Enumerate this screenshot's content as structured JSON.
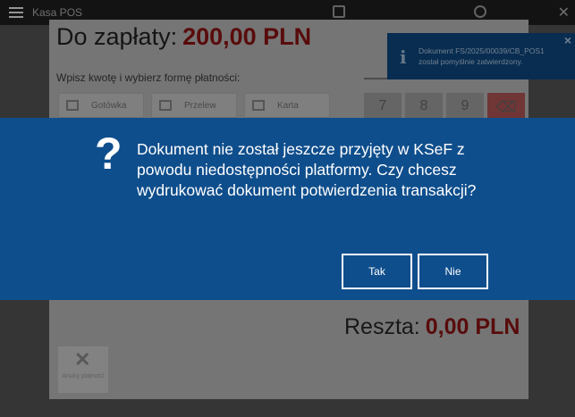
{
  "app": {
    "title": "Kasa POS"
  },
  "payment": {
    "due_label": "Do zapłaty:",
    "due_amount": "200,00 PLN",
    "hint": "Wpisz kwotę i wybierz formę płatności:",
    "methods": [
      {
        "label": "Gotówka",
        "icon": "cash-icon"
      },
      {
        "label": "Przelew",
        "icon": "transfer-icon"
      },
      {
        "label": "Karta",
        "icon": "card-icon"
      }
    ],
    "keypad": [
      "7",
      "8",
      "9",
      "⌫"
    ],
    "change_label": "Reszta:",
    "change_amount": "0,00 PLN",
    "cancel_label": "Anuluj płatność"
  },
  "toast": {
    "message": "Dokument FS/2025/00039/CB_POS1 został pomyślnie zatwierdzony.",
    "close": "×",
    "icon": "info-icon"
  },
  "modal": {
    "icon": "question-icon",
    "icon_glyph": "?",
    "message": "Dokument nie został jeszcze przyjęty w KSeF z powodu niedostępności platformy. Czy chcesz wydrukować dokument potwierdzenia transakcji?",
    "yes_label": "Tak",
    "no_label": "Nie"
  },
  "colors": {
    "modal_bg": "#0f4e8c",
    "toast_bg": "#0c3f70",
    "amount_accent": "#7c1010"
  }
}
